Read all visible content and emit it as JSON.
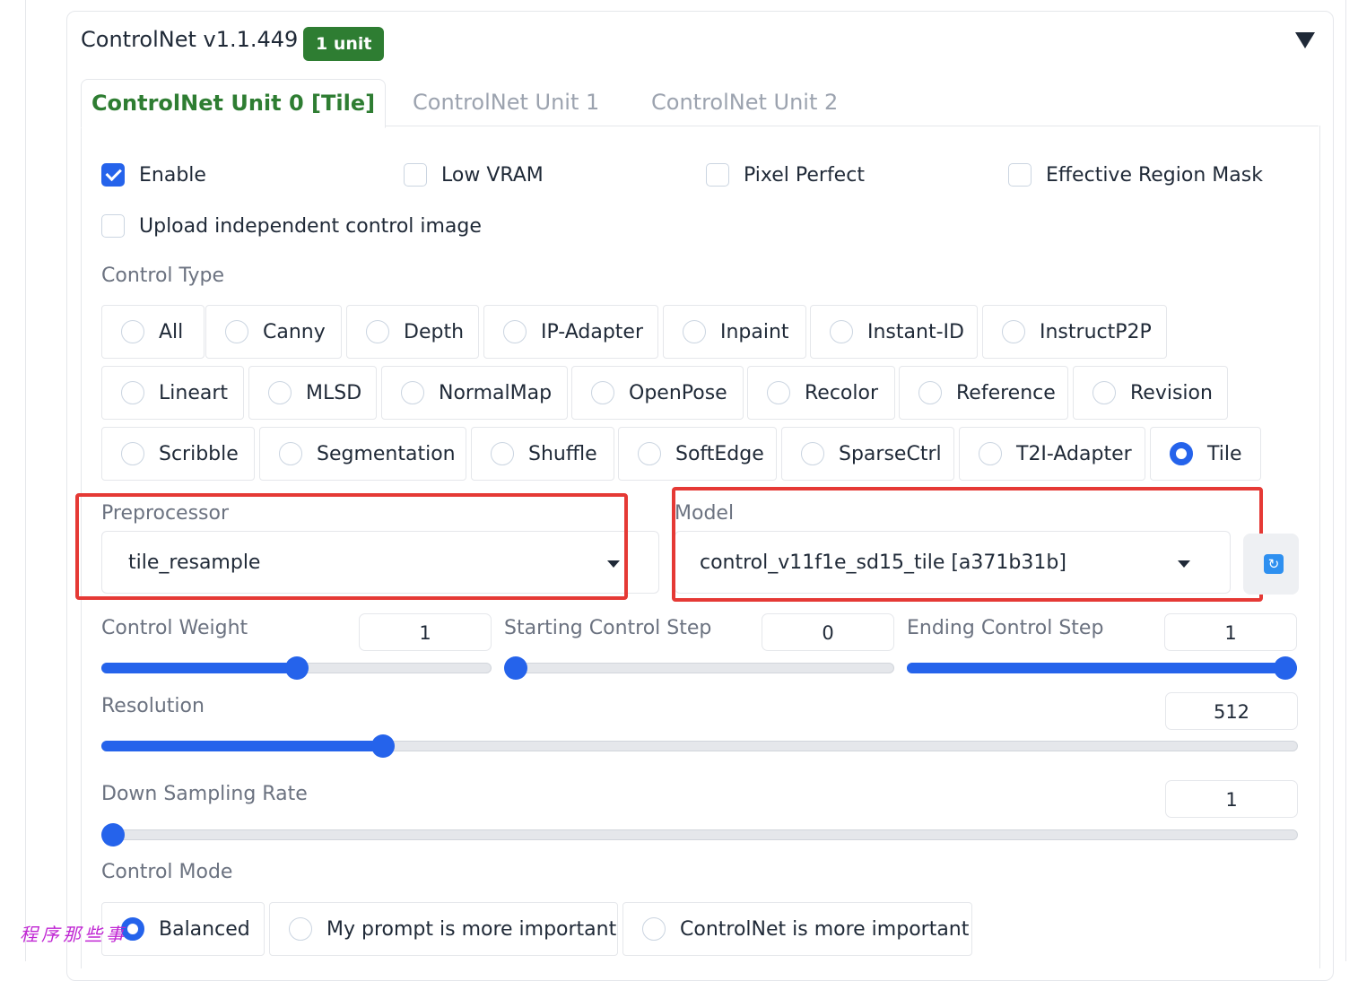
{
  "header": {
    "title": "ControlNet v1.1.449",
    "badge": "1 unit"
  },
  "tabs": [
    {
      "label": "ControlNet Unit 0 [Tile]",
      "active": true
    },
    {
      "label": "ControlNet Unit 1",
      "active": false
    },
    {
      "label": "ControlNet Unit 2",
      "active": false
    }
  ],
  "options": {
    "enable": {
      "label": "Enable",
      "checked": true
    },
    "low_vram": {
      "label": "Low VRAM",
      "checked": false
    },
    "pixel_perfect": {
      "label": "Pixel Perfect",
      "checked": false
    },
    "effective_region_mask": {
      "label": "Effective Region Mask",
      "checked": false
    },
    "upload_independent": {
      "label": "Upload independent control image",
      "checked": false
    }
  },
  "control_type": {
    "label": "Control Type",
    "selected": "Tile",
    "items": [
      "All",
      "Canny",
      "Depth",
      "IP-Adapter",
      "Inpaint",
      "Instant-ID",
      "InstructP2P",
      "Lineart",
      "MLSD",
      "NormalMap",
      "OpenPose",
      "Recolor",
      "Reference",
      "Revision",
      "Scribble",
      "Segmentation",
      "Shuffle",
      "SoftEdge",
      "SparseCtrl",
      "T2I-Adapter",
      "Tile"
    ]
  },
  "preprocessor": {
    "label": "Preprocessor",
    "value": "tile_resample"
  },
  "model": {
    "label": "Model",
    "value": "control_v11f1e_sd15_tile [a371b31b]"
  },
  "sliders": {
    "control_weight": {
      "label": "Control Weight",
      "value": "1",
      "fraction": 0.5
    },
    "starting_step": {
      "label": "Starting Control Step",
      "value": "0",
      "fraction": 0.0
    },
    "ending_step": {
      "label": "Ending Control Step",
      "value": "1",
      "fraction": 1.0
    },
    "resolution": {
      "label": "Resolution",
      "value": "512",
      "fraction": 0.23
    },
    "down_sampling": {
      "label": "Down Sampling Rate",
      "value": "1",
      "fraction": 0.0
    }
  },
  "control_mode": {
    "label": "Control Mode",
    "selected": "Balanced",
    "items": [
      "Balanced",
      "My prompt is more important",
      "ControlNet is more important"
    ]
  },
  "watermark": "程序那些事",
  "colors": {
    "accent": "#2563eb",
    "badge": "#2e7d32",
    "highlight": "#e53935"
  }
}
